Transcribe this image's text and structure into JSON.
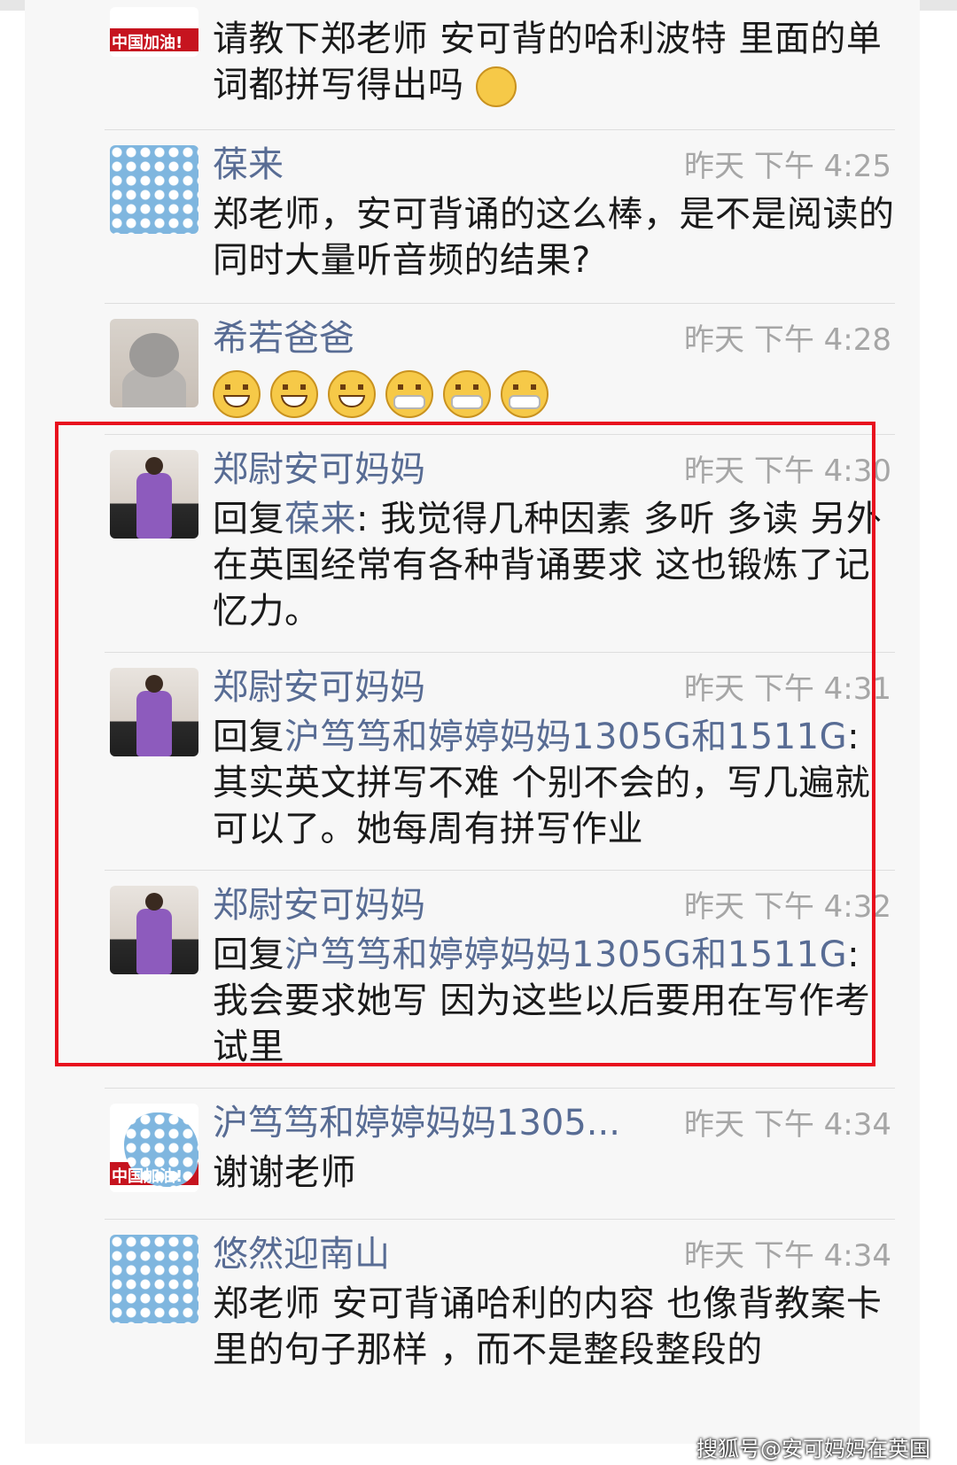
{
  "comments": [
    {
      "name": "",
      "time": "",
      "text": "请教下郑老师 安可背的哈利波特 里面的单词都拼写得出吗",
      "avatar_icon": "red-banner-avatar",
      "avatar_text": "中国加油!"
    },
    {
      "name": "葆来",
      "time": "昨天 下午 4:25",
      "text": "郑老师，安可背诵的这么棒，是不是阅读的同时大量听音频的结果?",
      "avatar_icon": "dotted-avatar"
    },
    {
      "name": "希若爸爸",
      "time": "昨天 下午 4:28",
      "text": "",
      "avatar_icon": "cat-avatar",
      "emojis": [
        "grin-emoji",
        "grin-emoji",
        "grin-emoji",
        "mask-emoji",
        "mask-emoji",
        "mask-emoji"
      ]
    },
    {
      "name": "郑尉安可妈妈",
      "time": "昨天 下午 4:30",
      "reply_prefix": "回复",
      "reply_to": "葆来",
      "text": ": 我觉得几种因素 多听 多读 另外在英国经常有各种背诵要求 这也锻炼了记忆力。",
      "avatar_icon": "girl-avatar"
    },
    {
      "name": "郑尉安可妈妈",
      "time": "昨天 下午 4:31",
      "reply_prefix": "回复",
      "reply_to": "沪笃笃和婷婷妈妈1305G和1511G",
      "text": ": 其实英文拼写不难 个别不会的，写几遍就可以了。她每周有拼写作业",
      "avatar_icon": "girl-avatar"
    },
    {
      "name": "郑尉安可妈妈",
      "time": "昨天 下午 4:32",
      "reply_prefix": "回复",
      "reply_to": "沪笃笃和婷婷妈妈1305G和1511G",
      "text": ": 我会要求她写 因为这些以后要用在写作考试里",
      "avatar_icon": "girl-avatar"
    },
    {
      "name": "沪笃笃和婷婷妈妈1305...",
      "time": "昨天 下午 4:34",
      "text": "谢谢老师",
      "avatar_icon": "red-banner-avatar",
      "avatar_text": "中国加油!"
    },
    {
      "name": "悠然迎南山",
      "time": "昨天 下午 4:34",
      "text": "郑老师 安可背诵哈利的内容 也像背教案卡里的句子那样 ，而不是整段整段的",
      "avatar_icon": "dotted-avatar"
    }
  ],
  "watermark": "搜狐号@安可妈妈在英国",
  "colors": {
    "link": "#586c94",
    "highlight_border": "#e8101e",
    "time": "#a6a6a6"
  }
}
